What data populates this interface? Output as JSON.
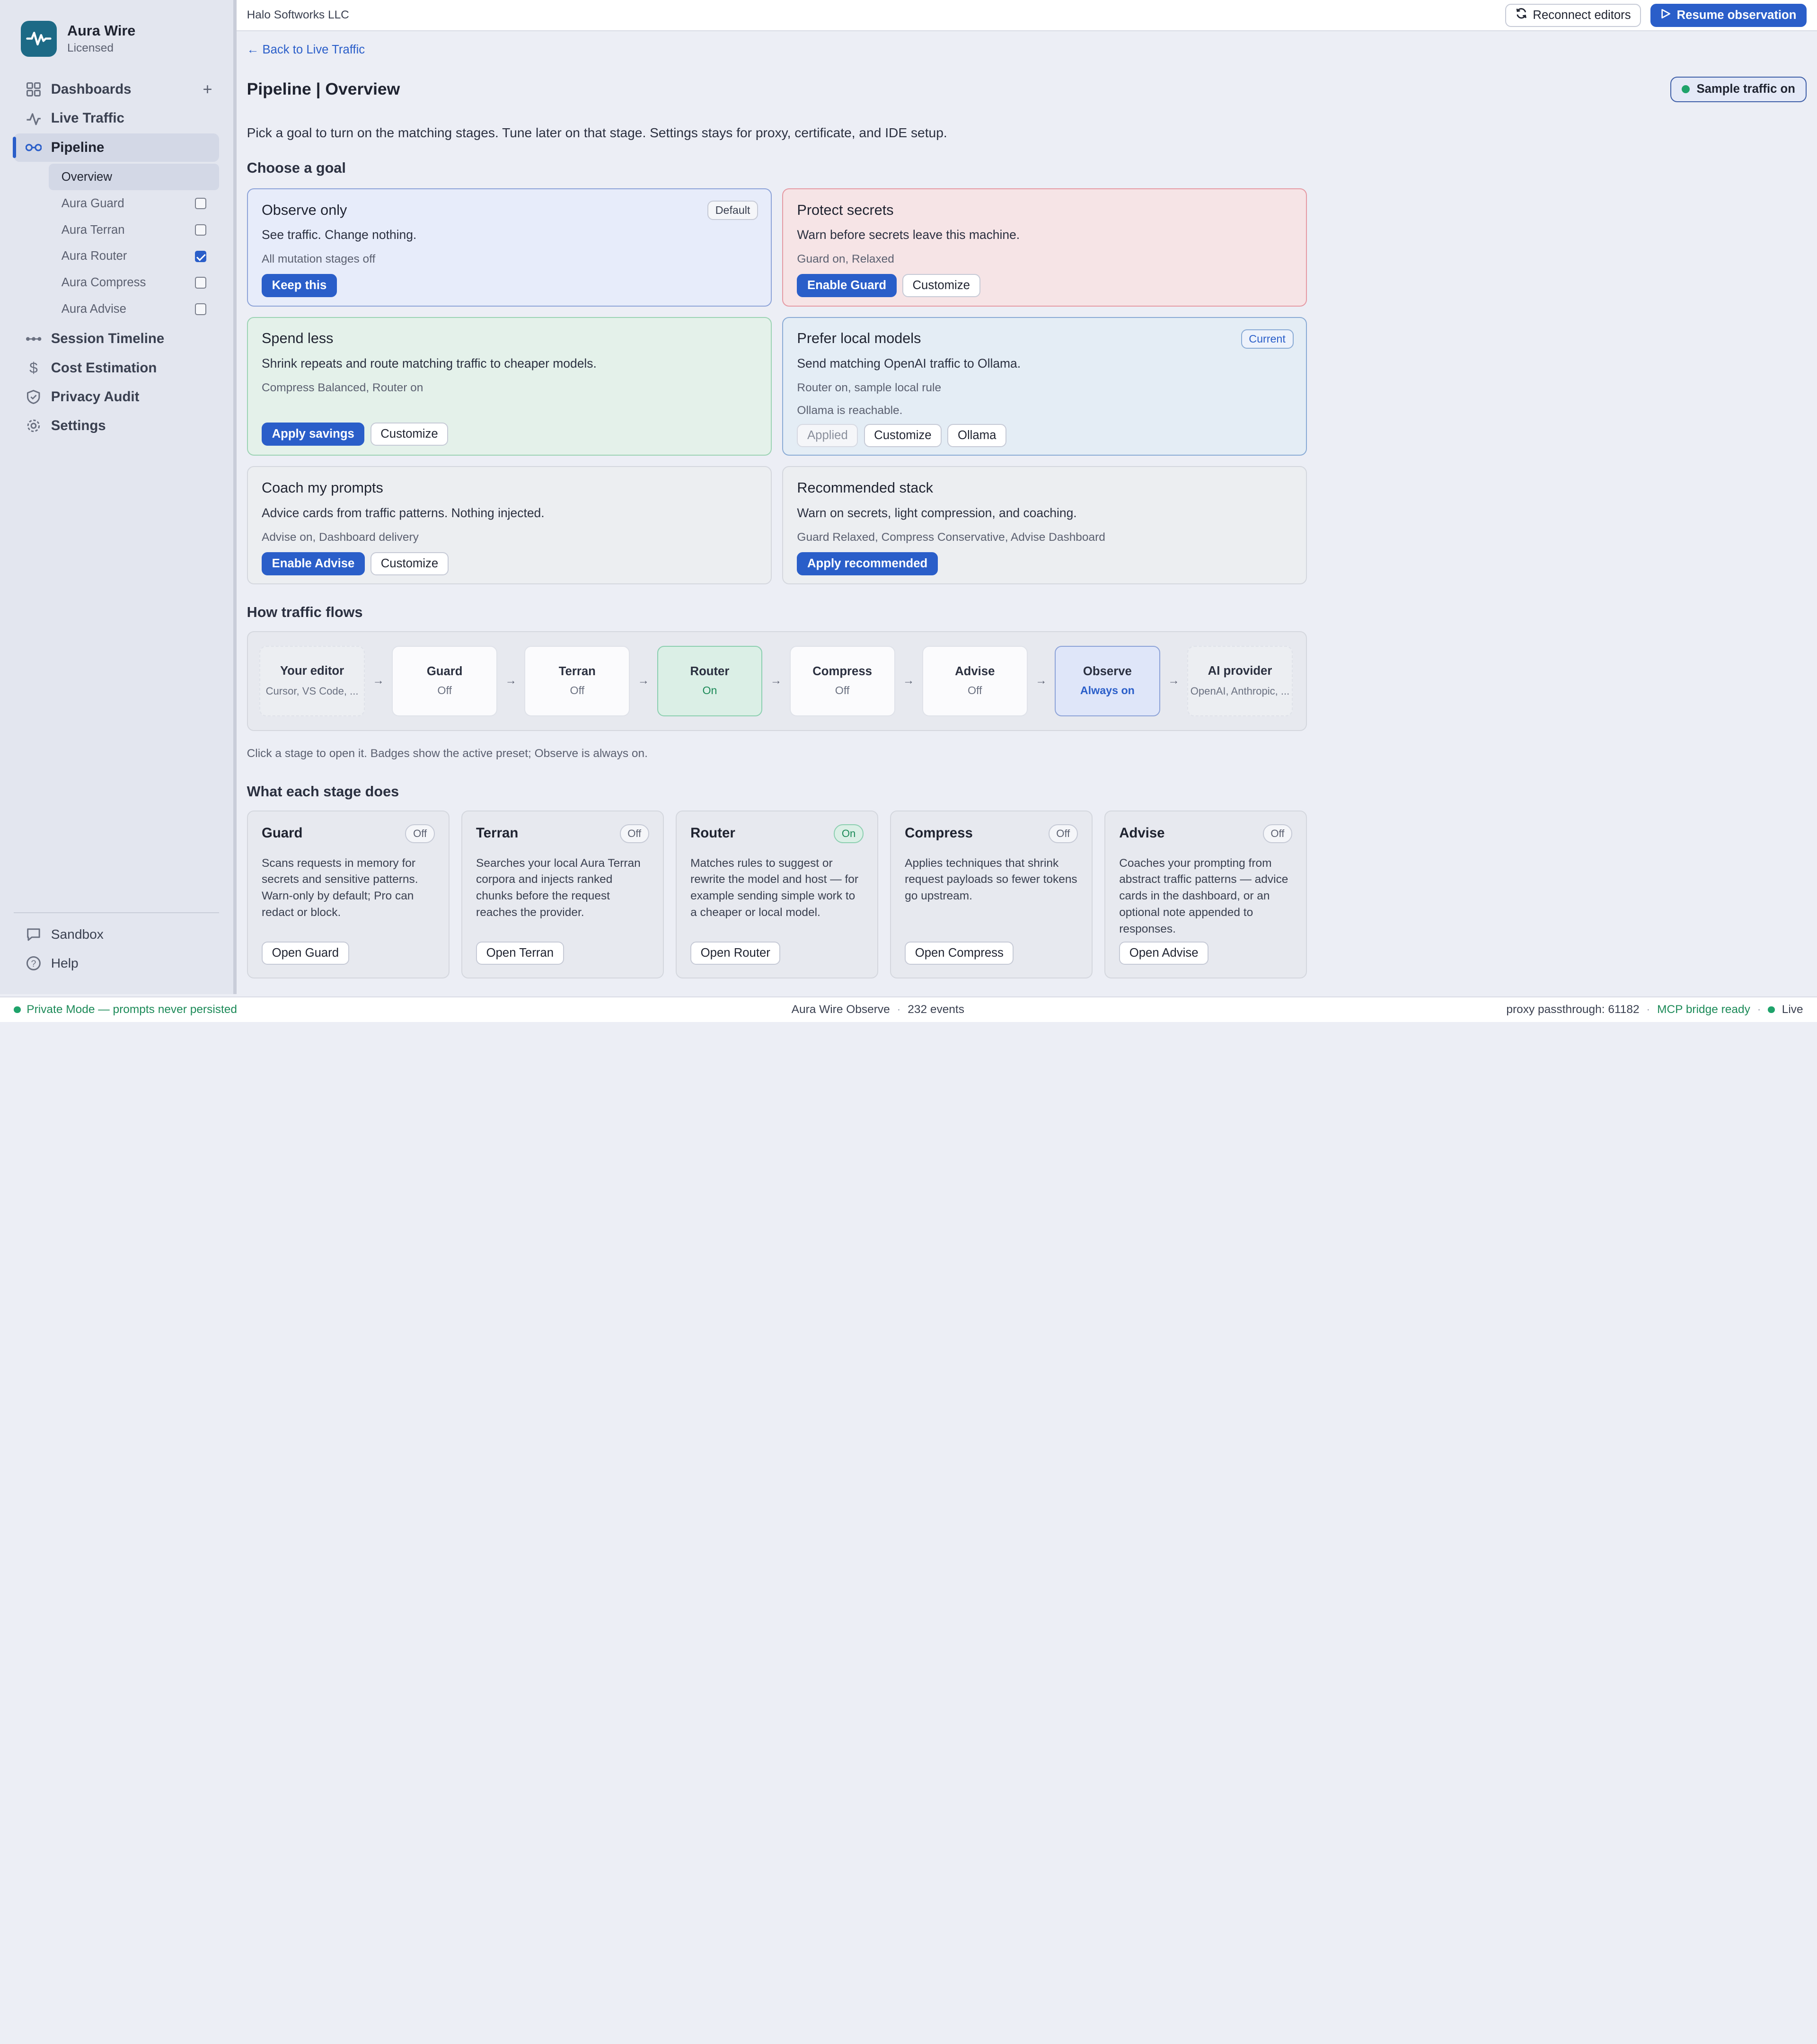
{
  "sidebar": {
    "brand": {
      "name": "Aura Wire",
      "license": "Licensed"
    },
    "nav": [
      {
        "label": "Dashboards",
        "icon": "grid-icon"
      },
      {
        "label": "Live Traffic",
        "icon": "activity-icon"
      },
      {
        "label": "Pipeline",
        "icon": "pipeline-icon"
      }
    ],
    "pipeline_sub": [
      {
        "label": "Overview",
        "checked": null
      },
      {
        "label": "Aura Guard",
        "checked": false
      },
      {
        "label": "Aura Terran",
        "checked": false
      },
      {
        "label": "Aura Router",
        "checked": true
      },
      {
        "label": "Aura Compress",
        "checked": false
      },
      {
        "label": "Aura Advise",
        "checked": false
      }
    ],
    "nav2": [
      {
        "label": "Session Timeline",
        "icon": "timeline-icon"
      },
      {
        "label": "Cost Estimation",
        "icon": "dollar-icon"
      },
      {
        "label": "Privacy Audit",
        "icon": "shield-icon"
      },
      {
        "label": "Settings",
        "icon": "gear-icon"
      }
    ],
    "bottom": [
      {
        "label": "Sandbox",
        "icon": "chat-icon"
      },
      {
        "label": "Help",
        "icon": "help-icon"
      }
    ]
  },
  "topbar": {
    "org": "Halo Softworks LLC",
    "reconnect_label": "Reconnect editors",
    "resume_label": "Resume observation"
  },
  "page": {
    "back_label": "← Back to Live Traffic",
    "title": "Pipeline | Overview",
    "sample_badge": "Sample traffic on",
    "intro": "Pick a goal to turn on the matching stages. Tune later on that stage. Settings stays for proxy, certificate, and IDE setup.",
    "goals_heading": "Choose a goal",
    "flow_heading": "How traffic flows",
    "flow_note": "Click a stage to open it. Badges show the active preset; Observe is always on.",
    "stages_heading": "What each stage does"
  },
  "goals": {
    "observe": {
      "title": "Observe only",
      "tag": "Default",
      "desc": "See traffic. Change nothing.",
      "meta": "All mutation stages off",
      "primary": "Keep this"
    },
    "protect": {
      "title": "Protect secrets",
      "desc": "Warn before secrets leave this machine.",
      "meta": "Guard on, Relaxed",
      "primary": "Enable Guard",
      "secondary": "Customize"
    },
    "spend": {
      "title": "Spend less",
      "desc": "Shrink repeats and route matching traffic to cheaper models.",
      "meta": "Compress Balanced, Router on",
      "primary": "Apply savings",
      "secondary": "Customize"
    },
    "local": {
      "title": "Prefer local models",
      "tag": "Current",
      "desc": "Send matching OpenAI traffic to Ollama.",
      "meta": "Router on, sample local rule",
      "meta2": "Ollama is reachable.",
      "applied": "Applied",
      "secondary": "Customize",
      "tertiary": "Ollama"
    },
    "coach": {
      "title": "Coach my prompts",
      "desc": "Advice cards from traffic patterns. Nothing injected.",
      "meta": "Advise on, Dashboard delivery",
      "primary": "Enable Advise",
      "secondary": "Customize"
    },
    "rec": {
      "title": "Recommended stack",
      "desc": "Warn on secrets, light compression, and coaching.",
      "meta": "Guard Relaxed, Compress Conservative, Advise Dashboard",
      "primary": "Apply recommended"
    }
  },
  "flow": {
    "arrow": "→",
    "stages": [
      {
        "name": "Your editor",
        "status": "Cursor, VS Code, ..."
      },
      {
        "name": "Guard",
        "status": "Off"
      },
      {
        "name": "Terran",
        "status": "Off"
      },
      {
        "name": "Router",
        "status": "On"
      },
      {
        "name": "Compress",
        "status": "Off"
      },
      {
        "name": "Advise",
        "status": "Off"
      },
      {
        "name": "Observe",
        "status": "Always on"
      },
      {
        "name": "AI provider",
        "status": "OpenAI, Anthropic, ..."
      }
    ]
  },
  "stage_cards": [
    {
      "name": "Guard",
      "status": "Off",
      "desc": "Scans requests in memory for secrets and sensitive patterns. Warn-only by default; Pro can redact or block.",
      "button": "Open Guard"
    },
    {
      "name": "Terran",
      "status": "Off",
      "desc": "Searches your local Aura Terran corpora and injects ranked chunks before the request reaches the provider.",
      "button": "Open Terran"
    },
    {
      "name": "Router",
      "status": "On",
      "desc": "Matches rules to suggest or rewrite the model and host — for example sending simple work to a cheaper or local model.",
      "button": "Open Router"
    },
    {
      "name": "Compress",
      "status": "Off",
      "desc": "Applies techniques that shrink request payloads so fewer tokens go upstream.",
      "button": "Open Compress"
    },
    {
      "name": "Advise",
      "status": "Off",
      "desc": "Coaches your prompting from abstract traffic patterns — advice cards in the dashboard, or an optional note appended to responses.",
      "button": "Open Advise"
    }
  ],
  "statusbar": {
    "private_mode": "Private Mode — prompts never persisted",
    "product": "Aura Wire Observe",
    "events": "232 events",
    "proxy": "proxy passthrough: 61182",
    "mcp": "MCP bridge ready",
    "live": "Live"
  },
  "colors": {
    "accent": "#2a5ec9",
    "success": "#1fa36b",
    "brand": "#1d6a86"
  }
}
